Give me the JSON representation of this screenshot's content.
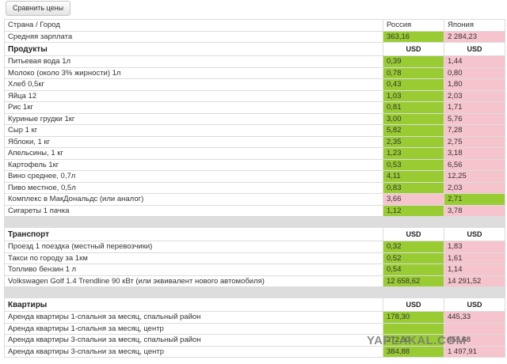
{
  "toolbar": {
    "compare_label": "Сравнить цены"
  },
  "header": {
    "label": "Страна / Город",
    "col1": "Россия",
    "col2": "Япония"
  },
  "salary": {
    "label": "Средняя зарплата",
    "v1": "363,16",
    "v2": "2 284,23",
    "c1": "green",
    "c2": "pink"
  },
  "sections": [
    {
      "title": "Продукты",
      "currency1": "USD",
      "currency2": "USD",
      "rows": [
        {
          "label": "Питьевая вода 1л",
          "v1": "0,39",
          "v2": "1,44",
          "c1": "green",
          "c2": "pink"
        },
        {
          "label": "Молоко (около 3% жирности) 1л",
          "v1": "0,78",
          "v2": "0,80",
          "c1": "green",
          "c2": "pink"
        },
        {
          "label": "Хлеб 0,5кг",
          "v1": "0,43",
          "v2": "1,80",
          "c1": "green",
          "c2": "pink"
        },
        {
          "label": "Яйца 12",
          "v1": "1,03",
          "v2": "2,03",
          "c1": "green",
          "c2": "pink"
        },
        {
          "label": "Рис 1кг",
          "v1": "0,81",
          "v2": "1,71",
          "c1": "green",
          "c2": "pink"
        },
        {
          "label": "Куриные грудки 1кг",
          "v1": "3,00",
          "v2": "5,76",
          "c1": "green",
          "c2": "pink"
        },
        {
          "label": "Сыр 1 кг",
          "v1": "5,82",
          "v2": "7,28",
          "c1": "green",
          "c2": "pink"
        },
        {
          "label": "Яблоки, 1 кг",
          "v1": "2,35",
          "v2": "2,75",
          "c1": "green",
          "c2": "pink"
        },
        {
          "label": "Апельсины, 1 кг",
          "v1": "1,23",
          "v2": "3,18",
          "c1": "green",
          "c2": "pink"
        },
        {
          "label": "Картофель 1кг",
          "v1": "0,53",
          "v2": "6,56",
          "c1": "green",
          "c2": "pink"
        },
        {
          "label": "Вино среднее, 0,7л",
          "v1": "4,11",
          "v2": "12,25",
          "c1": "green",
          "c2": "pink"
        },
        {
          "label": "Пиво местное, 0,5л",
          "v1": "0,83",
          "v2": "2,03",
          "c1": "green",
          "c2": "pink"
        },
        {
          "label": "Комплекс в МакДональдс (или аналог)",
          "v1": "3,66",
          "v2": "2,71",
          "c1": "pink",
          "c2": "green"
        },
        {
          "label": "Сигареты 1 пачка",
          "v1": "1,12",
          "v2": "3,78",
          "c1": "green",
          "c2": "pink"
        }
      ]
    },
    {
      "title": "Транспорт",
      "currency1": "USD",
      "currency2": "USD",
      "rows": [
        {
          "label": "Проезд 1 поездка (местный перевозчики)",
          "v1": "0,32",
          "v2": "1,83",
          "c1": "green",
          "c2": "pink"
        },
        {
          "label": "Такси по городу за 1км",
          "v1": "0,52",
          "v2": "1,61",
          "c1": "green",
          "c2": "pink"
        },
        {
          "label": "Топливо бензин 1 л",
          "v1": "0,54",
          "v2": "1,14",
          "c1": "green",
          "c2": "pink"
        },
        {
          "label": "Volkswagen Golf 1.4 Trendline 90 кВт (или эквивалент нового автомобиля)",
          "v1": "12 658,62",
          "v2": "14 291,52",
          "c1": "green",
          "c2": "pink"
        }
      ]
    },
    {
      "title": "Квартиры",
      "currency1": "USD",
      "currency2": "USD",
      "rows": [
        {
          "label": "Аренда квартиры 1-спальня за месяц, спальный район",
          "v1": "178,30",
          "v2": "445,33",
          "c1": "green",
          "c2": "pink"
        },
        {
          "label": "Аренда квартиры 1-спальня за месяц, центр",
          "v1": "",
          "v2": "",
          "c1": "green",
          "c2": "pink"
        },
        {
          "label": "Аренда квартиры 3-спальни за месяц, спальный район",
          "v1": "272,50",
          "v2": "855,68",
          "c1": "green",
          "c2": "pink"
        },
        {
          "label": "Аренда квартиры 3-спальни за месяц, центр",
          "v1": "384,88",
          "v2": "1 497,91",
          "c1": "green",
          "c2": "pink"
        }
      ]
    }
  ],
  "watermark": "YAPLAKAL.COM"
}
